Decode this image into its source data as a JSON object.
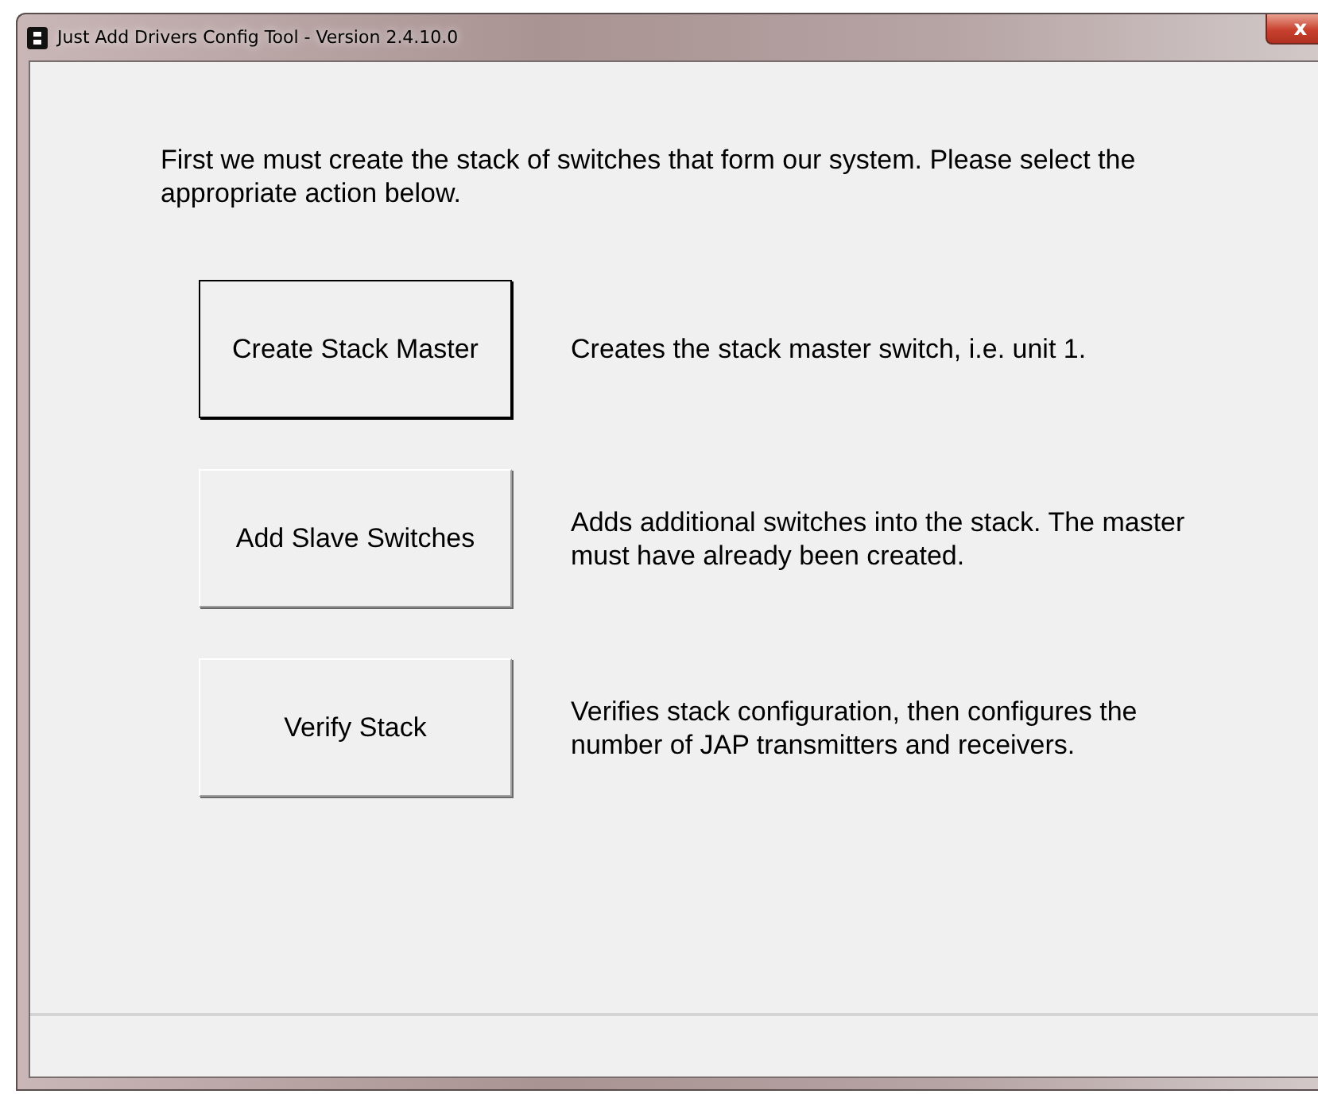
{
  "window": {
    "title": "Just Add Drivers Config Tool - Version 2.4.10.0",
    "close": "x"
  },
  "intro": "First we must create the stack of switches that form our system. Please select the appropriate action below.",
  "actions": [
    {
      "label": "Create Stack Master",
      "focused": true,
      "description": "Creates the stack master switch, i.e. unit 1."
    },
    {
      "label": "Add Slave Switches",
      "focused": false,
      "description": "Adds additional switches into the stack. The master must have already been created."
    },
    {
      "label": "Verify Stack",
      "focused": false,
      "description": "Verifies stack configuration, then configures the number of JAP transmitters and receivers."
    }
  ]
}
